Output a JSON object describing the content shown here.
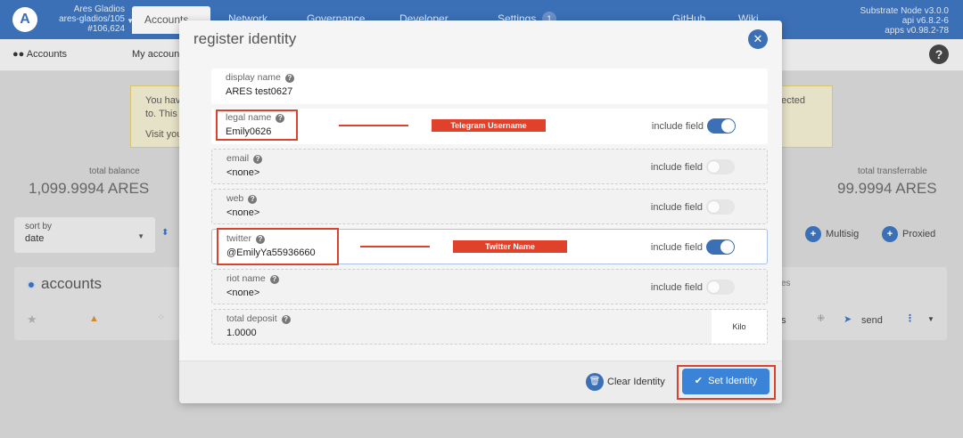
{
  "topbar": {
    "chain_name": "Ares Gladios",
    "chain_sub": "ares-gladios/105",
    "block": "#106,624",
    "nav": [
      "Accounts",
      "Network",
      "Governance",
      "Developer",
      "Settings",
      "GitHub",
      "Wiki"
    ],
    "settings_badge": "1",
    "node": [
      "Substrate Node v3.0.0",
      "api v6.8.2-6",
      "apps v0.98.2-78"
    ]
  },
  "subnav": {
    "accounts": "Accounts",
    "my_accounts": "My accoun"
  },
  "background": {
    "notice_left": [
      "You hav",
      "to. This",
      "Visit you"
    ],
    "notice_right": "ected",
    "total_balance_label": "total balance",
    "total_balance_value": "1,099.9994 ARES",
    "total_transferrable_label": "total transferrable",
    "total_transferrable_value": "99.9994 ARES",
    "sort_label": "sort by",
    "sort_value": "date",
    "multisig": "Multisig",
    "proxied": "Proxied",
    "accounts_title": "accounts",
    "col_fragment": "es",
    "row_fragment": "s",
    "send": "send"
  },
  "modal": {
    "title": "register identity",
    "fields": [
      {
        "label": "display name",
        "value": "ARES test0627"
      },
      {
        "label": "legal name",
        "value": "Emily0626",
        "include": "include field",
        "on": true
      },
      {
        "label": "email",
        "value": "<none>",
        "include": "include field",
        "on": false
      },
      {
        "label": "web",
        "value": "<none>",
        "include": "include field",
        "on": false
      },
      {
        "label": "twitter",
        "value": "@EmilyYa55936660",
        "include": "include field",
        "on": true
      },
      {
        "label": "riot name",
        "value": "<none>",
        "include": "include field",
        "on": false
      },
      {
        "label": "total deposit",
        "value": "1.0000",
        "unit": "Kilo"
      }
    ],
    "clear_label": "Clear Identity",
    "set_label": "Set Identity"
  },
  "annotations": {
    "telegram": "Telegram Username",
    "twitter": "Twitter Name"
  },
  "colors": {
    "accent": "#3b6fb6",
    "annotation": "#d9422e"
  }
}
